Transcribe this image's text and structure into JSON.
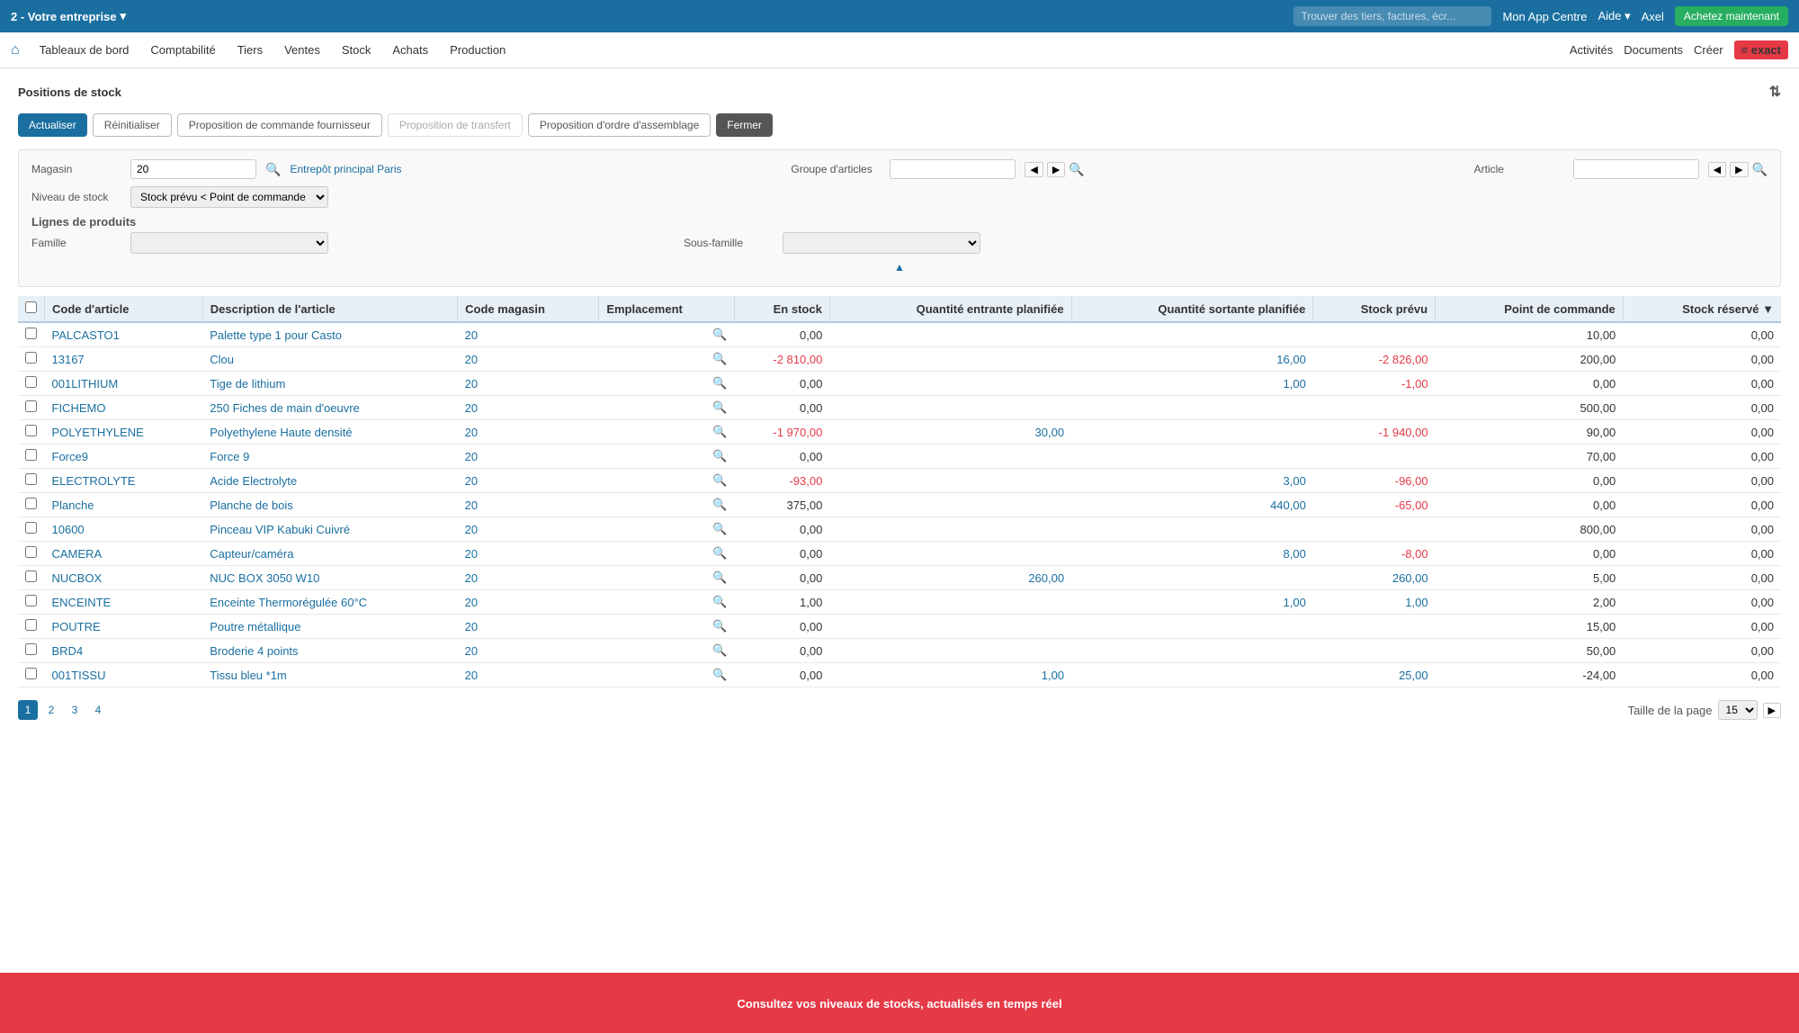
{
  "topbar": {
    "company": "2 - Votre entreprise",
    "chevron": "▾",
    "search_placeholder": "Trouver des tiers, factures, écr...",
    "mon_app_centre": "Mon App Centre",
    "aide": "Aide",
    "aide_chevron": "▾",
    "user": "Axel",
    "cta_label": "Achetez maintenant"
  },
  "navbar": {
    "home_icon": "⌂",
    "items": [
      "Tableaux de bord",
      "Comptabilité",
      "Tiers",
      "Ventes",
      "Stock",
      "Achats",
      "Production"
    ],
    "right": [
      "Activités",
      "Documents",
      "Créer"
    ],
    "logo": "≡ exact"
  },
  "page": {
    "title": "Positions de stock",
    "filter_icon": "⇅"
  },
  "toolbar": {
    "actualiser": "Actualiser",
    "reinitialiser": "Réinitialiser",
    "proposition_commande": "Proposition de commande fournisseur",
    "proposition_transfert": "Proposition de transfert",
    "proposition_assemblage": "Proposition d'ordre d'assemblage",
    "fermer": "Fermer"
  },
  "filters": {
    "magasin_label": "Magasin",
    "magasin_value": "20",
    "magasin_link": "Entrepôt principal Paris",
    "groupe_label": "Groupe d'articles",
    "article_label": "Article",
    "niveau_label": "Niveau de stock",
    "niveau_value": "Stock prévu < Point de commande",
    "lignes_label": "Lignes de produits",
    "famille_label": "Famille",
    "sous_famille_label": "Sous-famille"
  },
  "table": {
    "columns": [
      "Code d'article",
      "Description de l'article",
      "Code magasin",
      "Emplacement",
      "En stock",
      "Quantité entrante planifiée",
      "Quantité sortante planifiée",
      "Stock prévu",
      "Point de commande",
      "Stock réservé ▼"
    ],
    "rows": [
      {
        "code": "PALCASTO1",
        "description": "Palette type 1 pour Casto",
        "magasin": "20",
        "en_stock": "0,00",
        "qte_entrante": "",
        "qte_sortante": "",
        "stock_prevu": "",
        "point_commande": "10,00",
        "stock_reserve": "0,00"
      },
      {
        "code": "13167",
        "description": "Clou",
        "magasin": "20",
        "en_stock": "-2 810,00",
        "qte_entrante": "",
        "qte_sortante": "16,00",
        "stock_prevu": "-2 826,00",
        "point_commande": "200,00",
        "stock_reserve": "0,00"
      },
      {
        "code": "001LITHIUM",
        "description": "Tige de lithium",
        "magasin": "20",
        "en_stock": "0,00",
        "qte_entrante": "",
        "qte_sortante": "1,00",
        "stock_prevu": "-1,00",
        "point_commande": "0,00",
        "stock_reserve": "0,00"
      },
      {
        "code": "FICHEMO",
        "description": "250 Fiches de main d'oeuvre",
        "magasin": "20",
        "en_stock": "0,00",
        "qte_entrante": "",
        "qte_sortante": "",
        "stock_prevu": "",
        "point_commande": "500,00",
        "stock_reserve": "0,00"
      },
      {
        "code": "POLYETHYLENE",
        "description": "Polyethylene Haute densité",
        "magasin": "20",
        "en_stock": "-1 970,00",
        "qte_entrante": "30,00",
        "qte_sortante": "",
        "stock_prevu": "-1 940,00",
        "point_commande": "90,00",
        "stock_reserve": "0,00"
      },
      {
        "code": "Force9",
        "description": "Force 9",
        "magasin": "20",
        "en_stock": "0,00",
        "qte_entrante": "",
        "qte_sortante": "",
        "stock_prevu": "",
        "point_commande": "70,00",
        "stock_reserve": "0,00"
      },
      {
        "code": "ELECTROLYTE",
        "description": "Acide Electrolyte",
        "magasin": "20",
        "en_stock": "-93,00",
        "qte_entrante": "",
        "qte_sortante": "3,00",
        "stock_prevu": "-96,00",
        "point_commande": "0,00",
        "stock_reserve": "0,00"
      },
      {
        "code": "Planche",
        "description": "Planche de bois",
        "magasin": "20",
        "en_stock": "375,00",
        "qte_entrante": "",
        "qte_sortante": "440,00",
        "stock_prevu": "-65,00",
        "point_commande": "0,00",
        "stock_reserve": "0,00"
      },
      {
        "code": "10600",
        "description": "Pinceau VIP Kabuki Cuivré",
        "magasin": "20",
        "en_stock": "0,00",
        "qte_entrante": "",
        "qte_sortante": "",
        "stock_prevu": "",
        "point_commande": "800,00",
        "stock_reserve": "0,00"
      },
      {
        "code": "CAMERA",
        "description": "Capteur/caméra",
        "magasin": "20",
        "en_stock": "0,00",
        "qte_entrante": "",
        "qte_sortante": "8,00",
        "stock_prevu": "-8,00",
        "point_commande": "0,00",
        "stock_reserve": "0,00"
      },
      {
        "code": "NUCBOX",
        "description": "NUC BOX 3050 W10",
        "magasin": "20",
        "en_stock": "0,00",
        "qte_entrante": "260,00",
        "qte_sortante": "",
        "stock_prevu": "260,00",
        "point_commande": "5,00",
        "stock_reserve": "0,00"
      },
      {
        "code": "ENCEINTE",
        "description": "Enceinte Thermorégulée 60°C",
        "magasin": "20",
        "en_stock": "1,00",
        "qte_entrante": "",
        "qte_sortante": "1,00",
        "stock_prevu": "1,00",
        "point_commande": "2,00",
        "stock_reserve": "0,00"
      },
      {
        "code": "POUTRE",
        "description": "Poutre métallique",
        "magasin": "20",
        "en_stock": "0,00",
        "qte_entrante": "",
        "qte_sortante": "",
        "stock_prevu": "",
        "point_commande": "15,00",
        "stock_reserve": "0,00"
      },
      {
        "code": "BRD4",
        "description": "Broderie 4 points",
        "magasin": "20",
        "en_stock": "0,00",
        "qte_entrante": "",
        "qte_sortante": "",
        "stock_prevu": "",
        "point_commande": "50,00",
        "stock_reserve": "0,00"
      },
      {
        "code": "001TISSU",
        "description": "Tissu bleu *1m",
        "magasin": "20",
        "en_stock": "0,00",
        "qte_entrante": "1,00",
        "qte_sortante": "",
        "stock_prevu": "25,00",
        "point_commande": "-24,00",
        "stock_reserve": "0,00"
      }
    ]
  },
  "pagination": {
    "pages": [
      "1",
      "2",
      "3",
      "4"
    ],
    "current": "1",
    "taille_label": "Taille de la page",
    "taille_value": "15",
    "next_icon": "▶"
  },
  "banner": {
    "text": "Consultez vos niveaux de stocks, actualisés en temps réel"
  }
}
